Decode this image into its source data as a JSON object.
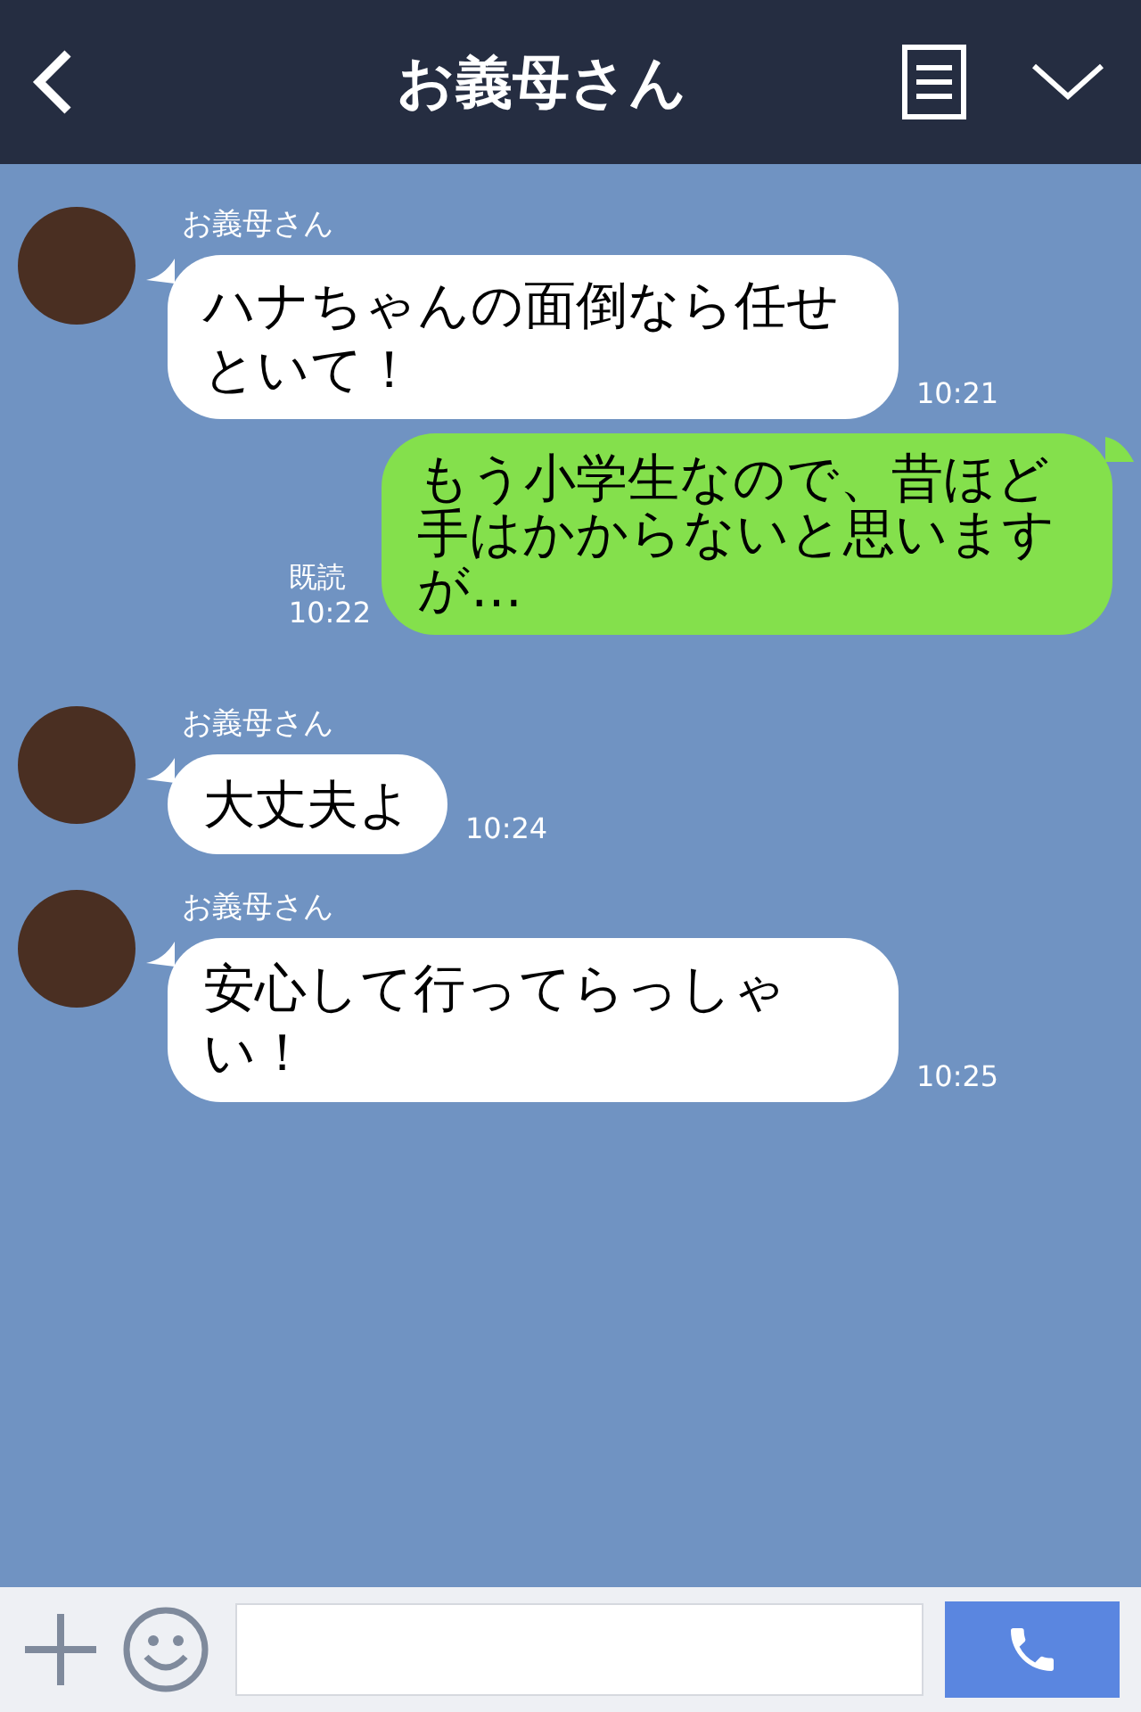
{
  "header": {
    "title": "お義母さん"
  },
  "messages": [
    {
      "kind": "incoming",
      "sender": "お義母さん",
      "text": "ハナちゃんの面倒なら任せといて！",
      "time": "10:21"
    },
    {
      "kind": "outgoing",
      "read_label": "既読",
      "text": "もう小学生なので、昔ほど手はかからないと思いますが…",
      "time": "10:22"
    },
    {
      "kind": "incoming",
      "sender": "お義母さん",
      "text": "大丈夫よ",
      "time": "10:24"
    },
    {
      "kind": "incoming",
      "sender": "お義母さん",
      "text": "安心して行ってらっしゃい！",
      "time": "10:25"
    }
  ]
}
